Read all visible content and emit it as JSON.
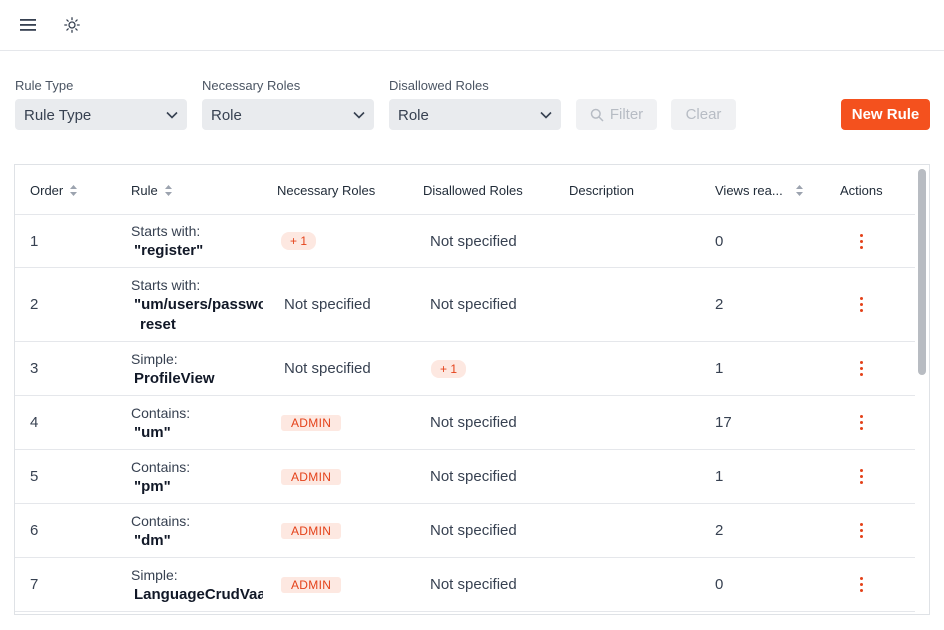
{
  "filters": {
    "rule_type": {
      "label": "Rule Type",
      "value": "Rule Type"
    },
    "necessary_roles": {
      "label": "Necessary Roles",
      "value": "Role"
    },
    "disallowed_roles": {
      "label": "Disallowed Roles",
      "value": "Role"
    },
    "filter_label": "Filter",
    "clear_label": "Clear",
    "new_rule_label": "New Rule"
  },
  "columns": {
    "order": "Order",
    "rule": "Rule",
    "necessary_roles": "Necessary Roles",
    "disallowed_roles": "Disallowed Roles",
    "description": "Description",
    "views": "Views rea...",
    "actions": "Actions"
  },
  "rows": [
    {
      "order": "1",
      "rule_type": "Starts with:",
      "rule_value": "\"register\"",
      "rule_value2": "",
      "necessary": "+ 1",
      "disallowed": "Not specified",
      "description": "",
      "views": "0"
    },
    {
      "order": "2",
      "rule_type": "Starts with:",
      "rule_value": "\"um/users/passwo",
      "rule_value2": "reset",
      "necessary": "Not specified",
      "disallowed": "Not specified",
      "description": "",
      "views": "2"
    },
    {
      "order": "3",
      "rule_type": "Simple:",
      "rule_value": "ProfileView",
      "rule_value2": "",
      "necessary": "Not specified",
      "disallowed": "+ 1",
      "description": "",
      "views": "1"
    },
    {
      "order": "4",
      "rule_type": "Contains:",
      "rule_value": "\"um\"",
      "rule_value2": "",
      "necessary": "ADMIN",
      "disallowed": "Not specified",
      "description": "",
      "views": "17"
    },
    {
      "order": "5",
      "rule_type": "Contains:",
      "rule_value": "\"pm\"",
      "rule_value2": "",
      "necessary": "ADMIN",
      "disallowed": "Not specified",
      "description": "",
      "views": "1"
    },
    {
      "order": "6",
      "rule_type": "Contains:",
      "rule_value": "\"dm\"",
      "rule_value2": "",
      "necessary": "ADMIN",
      "disallowed": "Not specified",
      "description": "",
      "views": "2"
    },
    {
      "order": "7",
      "rule_type": "Simple:",
      "rule_value": "LanguageCrudVaa",
      "rule_value2": "",
      "necessary": "ADMIN",
      "disallowed": "Not specified",
      "description": "",
      "views": "0"
    }
  ],
  "icons": {
    "menu": "menu-icon",
    "theme": "sun-icon",
    "search": "search-icon",
    "chevron": "chevron-down-icon",
    "sort": "sort-icon",
    "kebab": "more-vertical-icon"
  },
  "colors": {
    "accent": "#f4511e",
    "badge_bg": "#fde8e1",
    "badge_text": "#e4421a"
  }
}
